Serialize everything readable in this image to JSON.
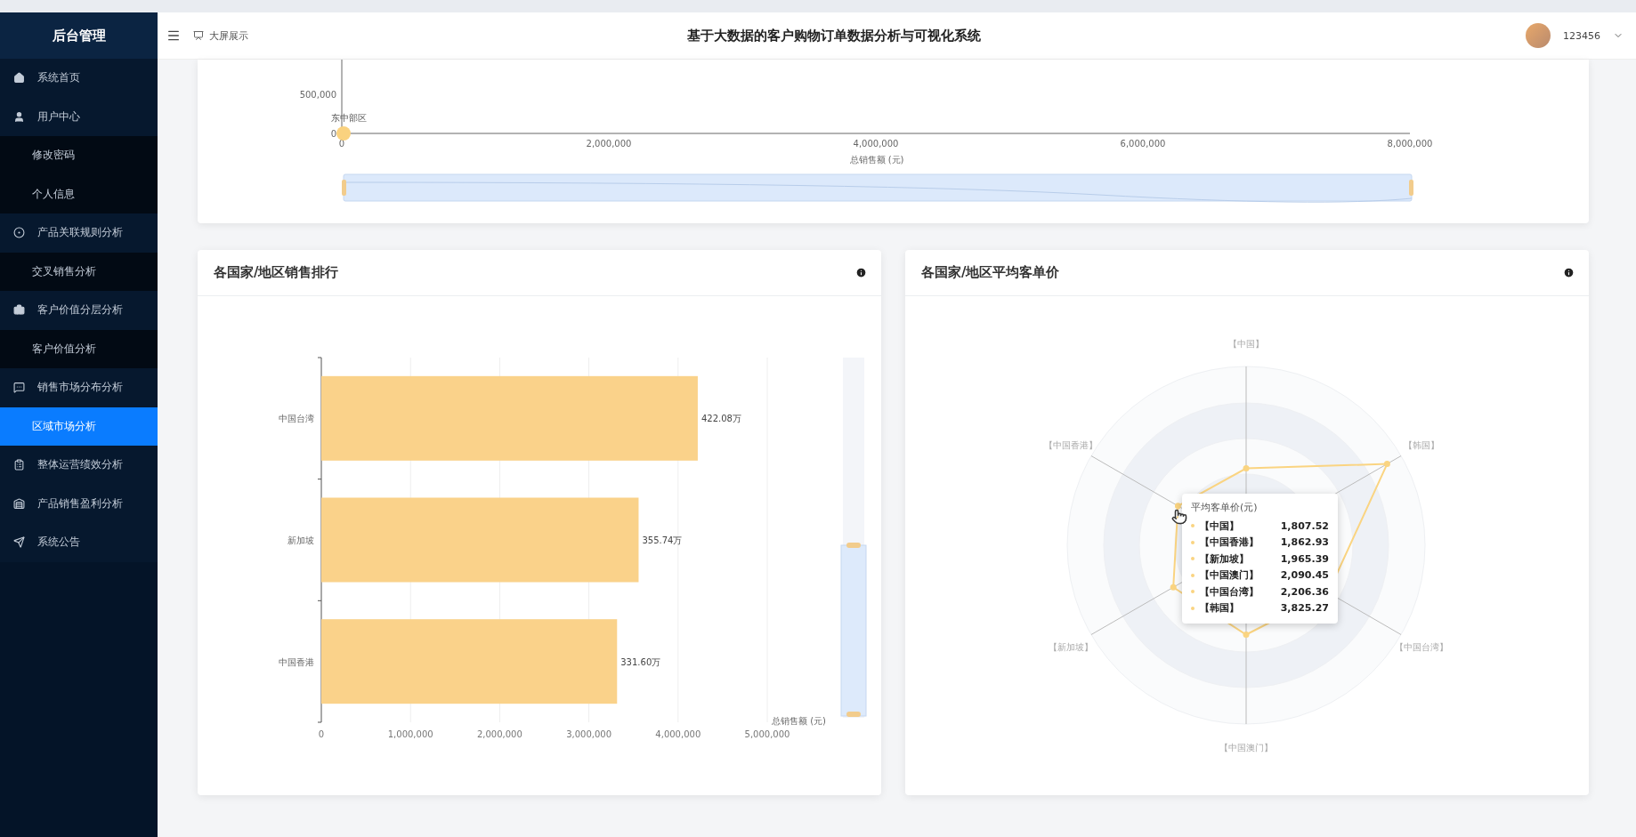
{
  "sidebar": {
    "title": "后台管理",
    "items": [
      {
        "label": "系统首页",
        "selected": false
      },
      {
        "label": "用户中心",
        "selected": false,
        "expanded": true,
        "children": [
          {
            "label": "修改密码",
            "selected": false
          },
          {
            "label": "个人信息",
            "selected": false
          }
        ]
      },
      {
        "label": "产品关联规则分析",
        "selected": false,
        "expanded": true,
        "children": [
          {
            "label": "交叉销售分析",
            "selected": false
          }
        ]
      },
      {
        "label": "客户价值分层分析",
        "selected": false,
        "expanded": true,
        "children": [
          {
            "label": "客户价值分析",
            "selected": false
          }
        ]
      },
      {
        "label": "销售市场分布分析",
        "selected": false,
        "expanded": true,
        "children": [
          {
            "label": "区域市场分析",
            "selected": true
          }
        ]
      },
      {
        "label": "整体运营绩效分析",
        "selected": false
      },
      {
        "label": "产品销售盈利分析",
        "selected": false
      },
      {
        "label": "系统公告",
        "selected": false
      }
    ]
  },
  "header": {
    "screen_link": "大屏展示",
    "title": "基于大数据的客户购物订单数据分析与可视化系统",
    "user": "123456"
  },
  "top_chart": {
    "chart_data": {
      "type": "scatter",
      "xlabel": "总销售额 (元)",
      "x": [
        0
      ],
      "xlim": [
        0,
        8000000
      ],
      "ylim": [
        0,
        1000000
      ],
      "xticks": [
        {
          "value": 0,
          "label": "0"
        },
        {
          "value": 2000000,
          "label": "2,000,000"
        },
        {
          "value": 4000000,
          "label": "4,000,000"
        },
        {
          "value": 6000000,
          "label": "6,000,000"
        },
        {
          "value": 8000000,
          "label": "8,000,000"
        }
      ],
      "yticks": [
        {
          "value": 0,
          "label": "0"
        },
        {
          "value": 500000,
          "label": "500,000"
        }
      ],
      "value_labels": [
        "东中部区"
      ],
      "series": [
        {
          "color": "#fad27f",
          "values": [
            0
          ]
        }
      ]
    }
  },
  "sales_ranking": {
    "title": "各国家/地区销售排行",
    "chart_data": {
      "type": "bar",
      "orientation": "horizontal",
      "xlabel": "总销售额 (元)",
      "grid": true,
      "xlim": [
        0,
        5000000
      ],
      "categories": [
        "中国台湾",
        "新加坡",
        "中国香港"
      ],
      "xticks": [
        {
          "value": 0,
          "label": "0"
        },
        {
          "value": 1000000,
          "label": "1,000,000"
        },
        {
          "value": 2000000,
          "label": "2,000,000"
        },
        {
          "value": 3000000,
          "label": "3,000,000"
        },
        {
          "value": 4000000,
          "label": "4,000,000"
        },
        {
          "value": 5000000,
          "label": "5,000,000"
        }
      ],
      "series": [
        {
          "color": "#fad28a",
          "values": [
            4220800,
            3557400,
            3316000
          ]
        }
      ],
      "value_labels": [
        "422.08万",
        "355.74万",
        "331.60万"
      ]
    }
  },
  "avg_price": {
    "title": "各国家/地区平均客单价",
    "axes": [
      "【中国】",
      "【韩国】",
      "【中国台湾】",
      "【中国澳门】",
      "【新加坡】",
      "【中国香港】"
    ],
    "tooltip": {
      "title": "平均客单价(元)",
      "rows": [
        {
          "name": "【中国】",
          "value": "1,807.52"
        },
        {
          "name": "【中国香港】",
          "value": "1,862.93"
        },
        {
          "name": "【新加坡】",
          "value": "1,965.39"
        },
        {
          "name": "【中国澳门】",
          "value": "2,090.45"
        },
        {
          "name": "【中国台湾】",
          "value": "2,206.36"
        },
        {
          "name": "【韩国】",
          "value": "3,825.27"
        }
      ]
    }
  }
}
